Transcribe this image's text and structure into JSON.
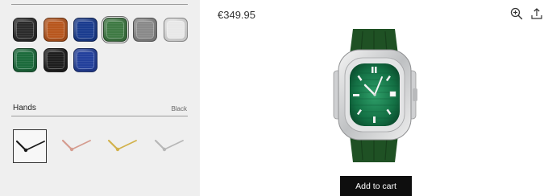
{
  "product": {
    "price": "€349.95",
    "add_to_cart_label": "Add to cart"
  },
  "toolbar": {
    "zoom_icon": "zoom-in-icon",
    "share_icon": "share-icon"
  },
  "dials": {
    "selected_index": 3,
    "swatches": [
      {
        "name": "black",
        "color": "#2b2b2b"
      },
      {
        "name": "orange",
        "color": "#b8571e"
      },
      {
        "name": "blue",
        "color": "#1a3c8f"
      },
      {
        "name": "green",
        "color": "#3f7a44"
      },
      {
        "name": "grey",
        "color": "#8a8a8a"
      },
      {
        "name": "white",
        "color": "#e8e8e8"
      },
      {
        "name": "green-skeleton",
        "color": "#1c6b3c"
      },
      {
        "name": "black-skeleton",
        "color": "#1e1e1e"
      },
      {
        "name": "blue-skeleton",
        "color": "#23409c"
      }
    ]
  },
  "hands": {
    "label": "Hands",
    "selected_value": "Black",
    "options": [
      {
        "name": "black",
        "color": "#1b1b1b"
      },
      {
        "name": "rose-gold",
        "color": "#d59c8f"
      },
      {
        "name": "gold",
        "color": "#d2b24c"
      },
      {
        "name": "silver",
        "color": "#b7b7b7"
      }
    ]
  },
  "colors": {
    "strap": "#1f5124",
    "dial": "#157a4a",
    "case": "#d9dadb",
    "accent": "#000000"
  }
}
